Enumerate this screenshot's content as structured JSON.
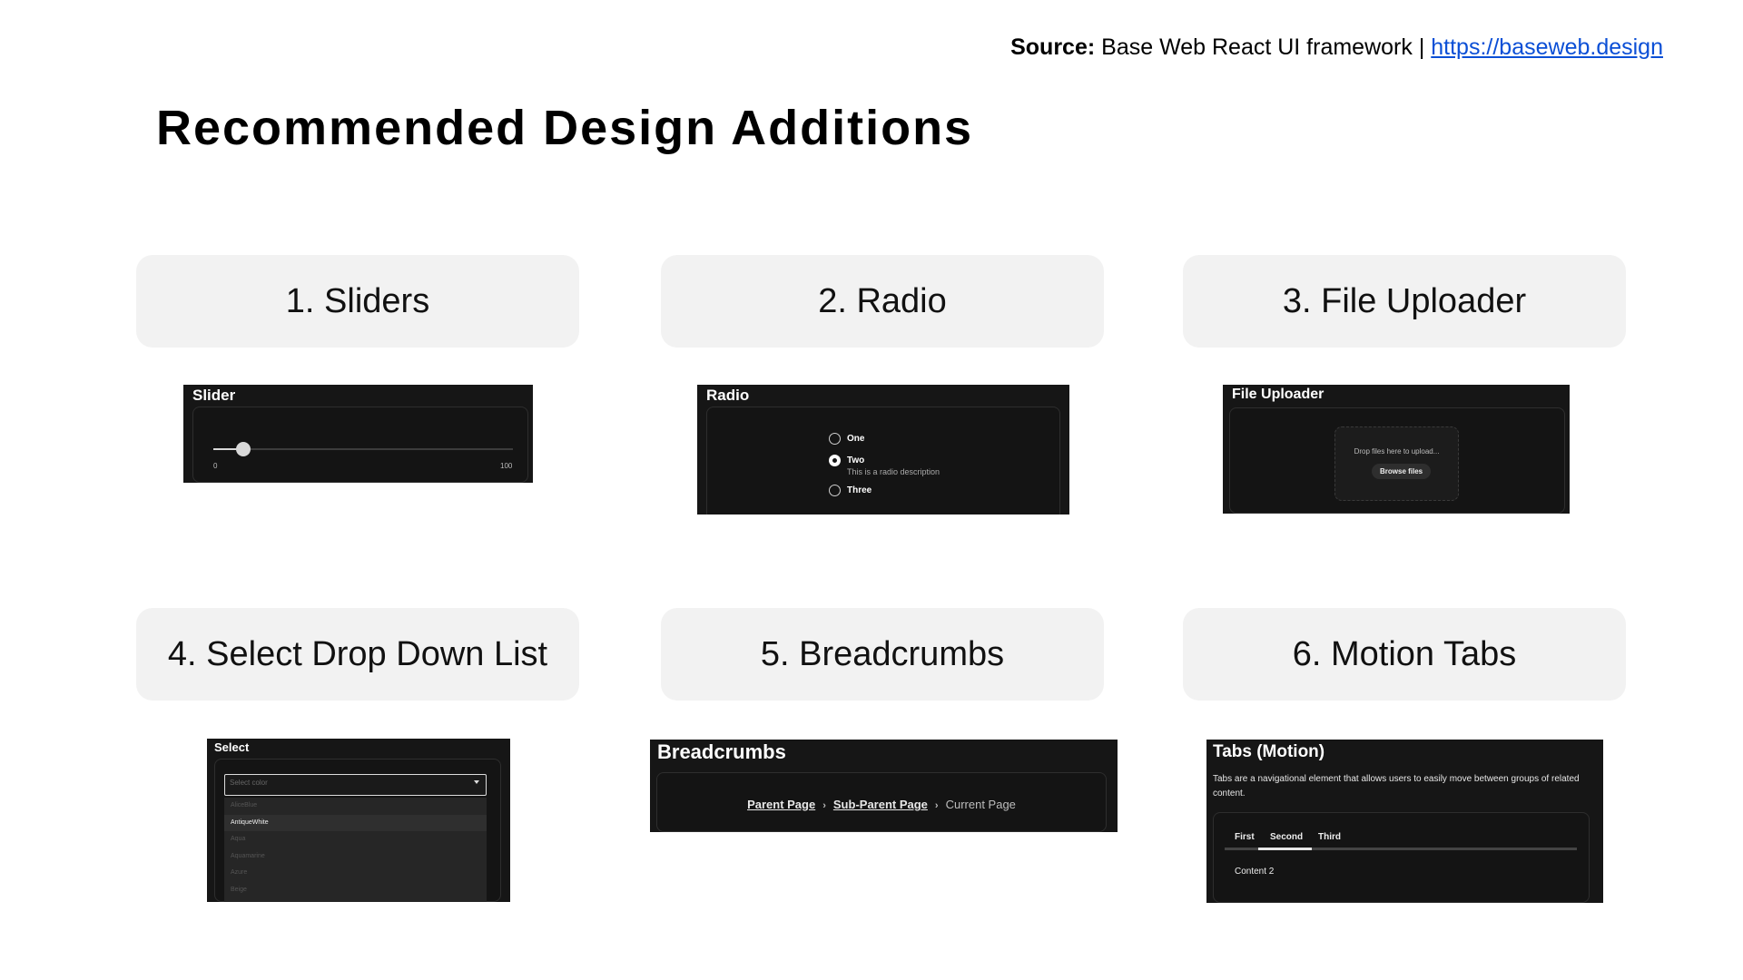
{
  "source": {
    "label": "Source:",
    "text": "Base Web React UI framework |",
    "link": "https://baseweb.design"
  },
  "title": "Recommended Design Additions",
  "cards": [
    "1. Sliders",
    "2. Radio",
    "3. File Uploader",
    "4. Select Drop Down List",
    "5. Breadcrumbs",
    "6. Motion Tabs"
  ],
  "slider": {
    "header": "Slider",
    "min": "0",
    "max": "100",
    "value": 0.1
  },
  "radio": {
    "header": "Radio",
    "options": [
      {
        "label": "One",
        "checked": false
      },
      {
        "label": "Two",
        "checked": true
      },
      {
        "label": "Three",
        "checked": false
      }
    ],
    "description": "This is a radio description"
  },
  "uploader": {
    "header": "File Uploader",
    "drop_text": "Drop files here to upload...",
    "button": "Browse files"
  },
  "select": {
    "header": "Select",
    "placeholder": "Select color",
    "options": [
      "AliceBlue",
      "AntiqueWhite",
      "Aqua",
      "Aquamarine",
      "Azure",
      "Beige"
    ],
    "highlighted": "AntiqueWhite"
  },
  "breadcrumbs": {
    "header": "Breadcrumbs",
    "parent": "Parent Page",
    "sub_parent": "Sub-Parent Page",
    "current": "Current Page",
    "separator": "›"
  },
  "tabs": {
    "header": "Tabs (Motion)",
    "description": "Tabs are a navigational element that allows users to easily move between groups of related content.",
    "items": [
      "First",
      "Second",
      "Third"
    ],
    "active": "Second",
    "content": "Content 2"
  }
}
